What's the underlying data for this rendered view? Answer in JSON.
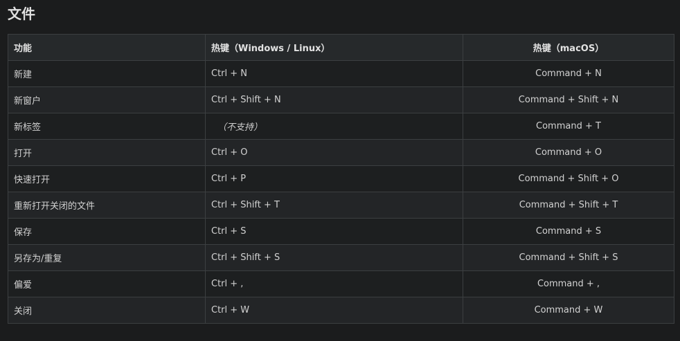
{
  "section": {
    "title": "文件"
  },
  "table": {
    "headers": {
      "function": "功能",
      "windows_linux": "热键（Windows / Linux）",
      "macos": "热键（macOS）"
    },
    "rows": [
      {
        "function": "新建",
        "windows_linux": "Ctrl + N",
        "macos": "Command + N"
      },
      {
        "function": "新窗户",
        "windows_linux": "Ctrl + Shift + N",
        "macos": "Command + Shift + N"
      },
      {
        "function": "新标签",
        "windows_linux": "（不支持）",
        "macos": "Command + T"
      },
      {
        "function": "打开",
        "windows_linux": "Ctrl + O",
        "macos": "Command + O"
      },
      {
        "function": "快速打开",
        "windows_linux": "Ctrl + P",
        "macos": "Command + Shift + O"
      },
      {
        "function": "重新打开关闭的文件",
        "windows_linux": "Ctrl + Shift + T",
        "macos": "Command + Shift + T"
      },
      {
        "function": "保存",
        "windows_linux": "Ctrl + S",
        "macos": "Command + S"
      },
      {
        "function": "另存为/重复",
        "windows_linux": "Ctrl + Shift + S",
        "macos": "Command + Shift + S"
      },
      {
        "function": "偏爱",
        "windows_linux": "Ctrl + ,",
        "macos": "Command + ,"
      },
      {
        "function": "关闭",
        "windows_linux": "Ctrl + W",
        "macos": "Command + W"
      }
    ]
  }
}
